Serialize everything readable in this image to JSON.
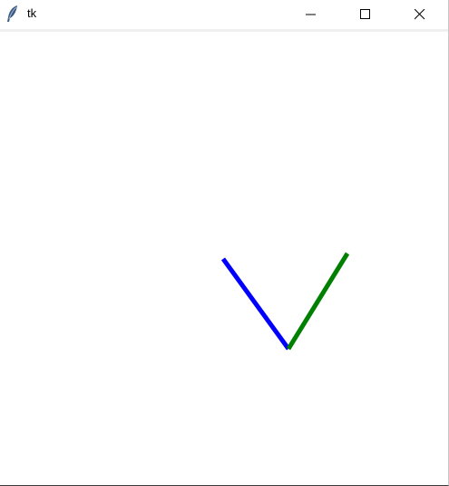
{
  "window": {
    "title": "tk",
    "app_icon": "feather-icon",
    "controls": {
      "minimize_icon": "minimize-icon",
      "maximize_icon": "maximize-icon",
      "close_icon": "close-icon"
    }
  },
  "canvas": {
    "background": "#ffffff",
    "lines": [
      {
        "name": "blue-line",
        "color": "#0000ff"
      },
      {
        "name": "green-line",
        "color": "#008000"
      }
    ]
  }
}
